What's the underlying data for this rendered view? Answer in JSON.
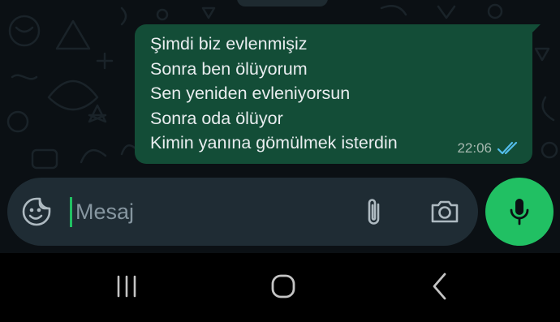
{
  "message": {
    "lines": [
      "Şimdi biz evlenmişiz",
      "Sonra ben ölüyorum",
      "Sen yeniden evleniyorsun",
      "Sonra oda ölüyor",
      "Kimin yanına gömülmek isterdin"
    ],
    "time": "22:06",
    "status_icon": "double-check-icon"
  },
  "composer": {
    "placeholder": "Mesaj",
    "emoji_icon": "sticker-icon",
    "attach_icon": "paperclip-icon",
    "camera_icon": "camera-icon",
    "send_icon": "microphone-icon"
  },
  "navigation": {
    "recents_icon": "recents-icon",
    "home_icon": "home-icon",
    "back_icon": "back-icon"
  },
  "colors": {
    "background": "#0b1014",
    "outgoing_bubble": "#134d37",
    "input_background": "#1f2c34",
    "accent": "#21c063",
    "read_ticks": "#53bdeb"
  }
}
